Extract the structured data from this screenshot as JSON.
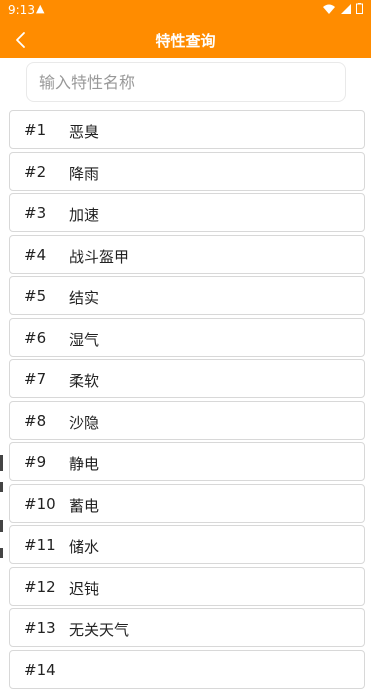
{
  "status_bar": {
    "time": "9:13",
    "warning_icon": "warning-icon",
    "system_icons": [
      "wifi-icon",
      "signal-icon",
      "battery-icon"
    ]
  },
  "header": {
    "title": "特性查询",
    "back_icon": "chevron-left-icon"
  },
  "search": {
    "placeholder": "输入特性名称",
    "value": ""
  },
  "abilities": [
    {
      "num": "#1",
      "name": "恶臭"
    },
    {
      "num": "#2",
      "name": "降雨"
    },
    {
      "num": "#3",
      "name": "加速"
    },
    {
      "num": "#4",
      "name": "战斗盔甲"
    },
    {
      "num": "#5",
      "name": "结实"
    },
    {
      "num": "#6",
      "name": "湿气"
    },
    {
      "num": "#7",
      "name": "柔软"
    },
    {
      "num": "#8",
      "name": "沙隐"
    },
    {
      "num": "#9",
      "name": "静电"
    },
    {
      "num": "#10",
      "name": "蓄电"
    },
    {
      "num": "#11",
      "name": "储水"
    },
    {
      "num": "#12",
      "name": "迟钝"
    },
    {
      "num": "#13",
      "name": "无关天气"
    },
    {
      "num": "#14",
      "name": ""
    }
  ],
  "colors": {
    "accent": "#ff8c00",
    "row_border": "#d8d8d8"
  }
}
